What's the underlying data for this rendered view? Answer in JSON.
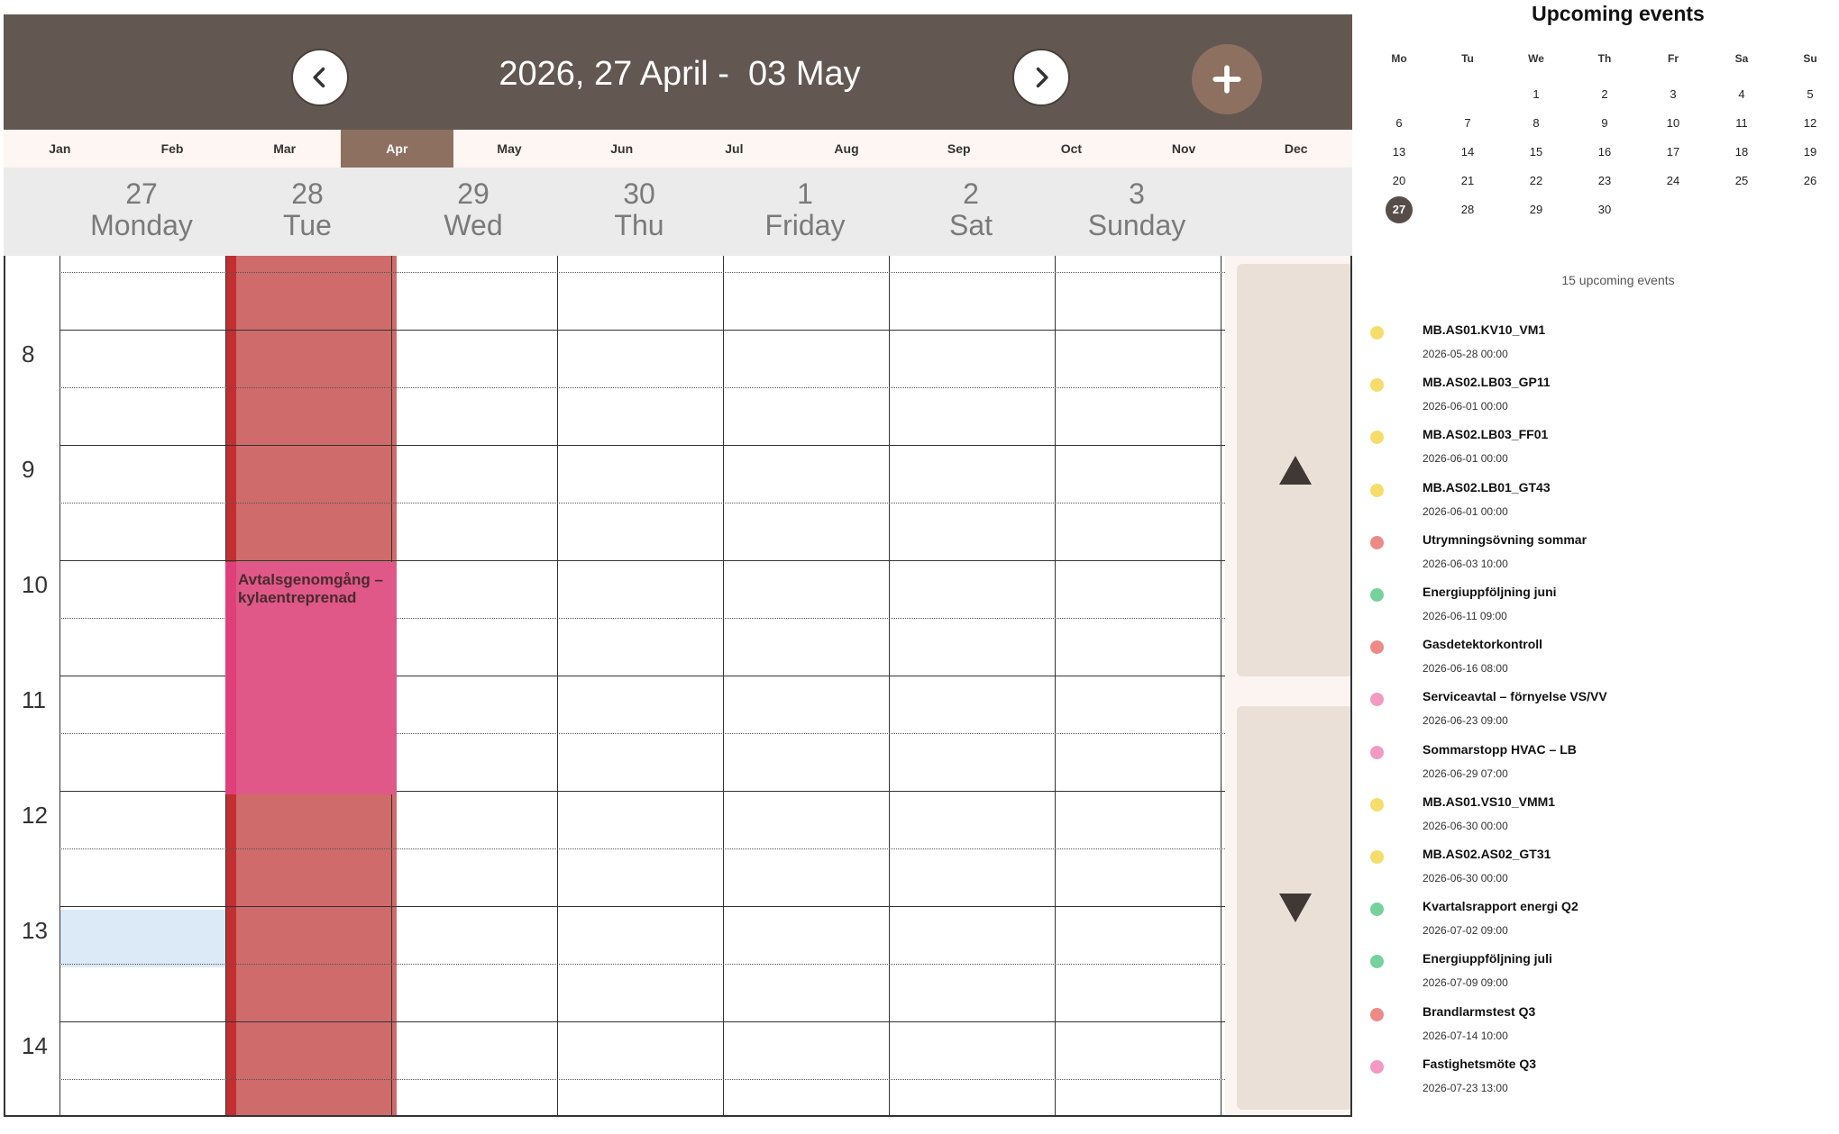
{
  "header": {
    "range_title": "2026, 27 April -  03 May",
    "prev_icon": "chevron-left-icon",
    "next_icon": "chevron-right-icon",
    "add_icon": "plus-icon",
    "colors": {
      "header_bg": "#635751",
      "accent": "#8d7060"
    }
  },
  "months": {
    "items": [
      "Jan",
      "Feb",
      "Mar",
      "Apr",
      "May",
      "Jun",
      "Jul",
      "Aug",
      "Sep",
      "Oct",
      "Nov",
      "Dec"
    ],
    "active": "Apr"
  },
  "days": [
    {
      "date": "27",
      "name": "Monday"
    },
    {
      "date": "28",
      "name": "Tue"
    },
    {
      "date": "29",
      "name": "Wed"
    },
    {
      "date": "30",
      "name": "Thu"
    },
    {
      "date": "1",
      "name": "Friday"
    },
    {
      "date": "2",
      "name": "Sat"
    },
    {
      "date": "3",
      "name": "Sunday"
    }
  ],
  "hours": [
    "8",
    "9",
    "10",
    "11",
    "12",
    "13",
    "14"
  ],
  "event": {
    "title": "Avtalsgenomgång – kylaentreprenad",
    "day": "Tue",
    "start": "10",
    "end": "12",
    "color": "#df5888"
  },
  "all_day_color": "#cf6b6b",
  "scroll": {
    "up_icon": "triangle-up-icon",
    "down_icon": "triangle-down-icon"
  },
  "sidebar": {
    "title": "Upcoming events",
    "weekdays": [
      "Mo",
      "Tu",
      "We",
      "Th",
      "Fr",
      "Sa",
      "Su"
    ],
    "weeks": [
      [
        "",
        "",
        "1",
        "2",
        "3",
        "4",
        "5"
      ],
      [
        "6",
        "7",
        "8",
        "9",
        "10",
        "11",
        "12"
      ],
      [
        "13",
        "14",
        "15",
        "16",
        "17",
        "18",
        "19"
      ],
      [
        "20",
        "21",
        "22",
        "23",
        "24",
        "25",
        "26"
      ],
      [
        "27",
        "28",
        "29",
        "30",
        "",
        "",
        ""
      ]
    ],
    "today": "27",
    "count_text": "15 upcoming events",
    "events": [
      {
        "name": "MB.AS01.KV10_VM1",
        "date": "2026-05-28 00:00",
        "color": "#f6dc6a"
      },
      {
        "name": "MB.AS02.LB03_GP11",
        "date": "2026-06-01 00:00",
        "color": "#f6dc6a"
      },
      {
        "name": "MB.AS02.LB03_FF01",
        "date": "2026-06-01 00:00",
        "color": "#f6dc6a"
      },
      {
        "name": "MB.AS02.LB01_GT43",
        "date": "2026-06-01 00:00",
        "color": "#f6dc6a"
      },
      {
        "name": "Utrymningsövning sommar",
        "date": "2026-06-03 10:00",
        "color": "#ee8a86"
      },
      {
        "name": "Energiuppföljning juni",
        "date": "2026-06-11 09:00",
        "color": "#74d29a"
      },
      {
        "name": "Gasdetektorkontroll",
        "date": "2026-06-16 08:00",
        "color": "#ee8a86"
      },
      {
        "name": "Serviceavtal – förnyelse VS/VV",
        "date": "2026-06-23 09:00",
        "color": "#f29ac4"
      },
      {
        "name": "Sommarstopp HVAC – LB",
        "date": "2026-06-29 07:00",
        "color": "#f29ac4"
      },
      {
        "name": "MB.AS01.VS10_VMM1",
        "date": "2026-06-30 00:00",
        "color": "#f6dc6a"
      },
      {
        "name": "MB.AS02.AS02_GT31",
        "date": "2026-06-30 00:00",
        "color": "#f6dc6a"
      },
      {
        "name": "Kvartalsrapport energi Q2",
        "date": "2026-07-02 09:00",
        "color": "#74d29a"
      },
      {
        "name": "Energiuppföljning juli",
        "date": "2026-07-09 09:00",
        "color": "#74d29a"
      },
      {
        "name": "Brandlarmstest Q3",
        "date": "2026-07-14 10:00",
        "color": "#ee8a86"
      },
      {
        "name": "Fastighetsmöte Q3",
        "date": "2026-07-23 13:00",
        "color": "#f29ac4"
      }
    ]
  }
}
